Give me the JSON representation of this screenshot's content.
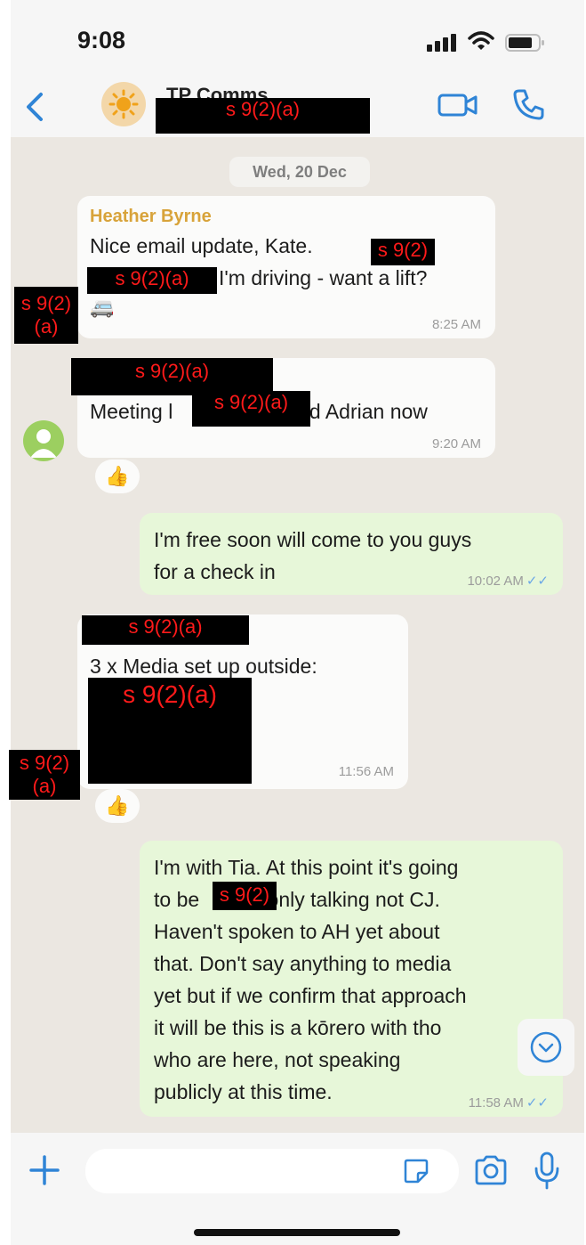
{
  "status_bar": {
    "time": "9:08",
    "signal_icon": "cellular-signal-icon",
    "wifi_icon": "wifi-icon",
    "battery_icon": "battery-icon"
  },
  "header": {
    "back_icon": "chevron-left-icon",
    "group_name": "TP Comms",
    "group_avatar_icon": "sun-icon",
    "subtitle_redaction": "s 9(2)(a)",
    "video_icon": "video-camera-icon",
    "call_icon": "phone-icon",
    "accent_color": "#2f84d6"
  },
  "chat": {
    "date": "Wed, 20 Dec",
    "messages": [
      {
        "sender": "Heather Byrne",
        "line1": "Nice email update, Kate.",
        "line1_redaction": "s 9(2)",
        "line2_redaction": "s 9(2)(a)",
        "line2": "I'm driving - want a lift?",
        "emoji": "🚐",
        "time": "8:25 AM",
        "avatar_redaction": "s 9(2)\n(a)"
      },
      {
        "sender_redaction": "s 9(2)(a)",
        "text_start": "Meeting l",
        "text_redaction": "s 9(2)(a)",
        "text_end": "and Adrian now",
        "time": "9:20 AM",
        "reaction": "👍"
      },
      {
        "line1": "I'm free soon will come to you guys",
        "line2": "for a check in",
        "time": "10:02 AM",
        "ticks": "✓✓"
      },
      {
        "sender_redaction": "s 9(2)(a)",
        "line1": "3 x Media set up outside:",
        "body_redaction": "s 9(2)(a)",
        "time": "11:56 AM",
        "avatar_redaction": "s 9(2)\n(a)",
        "reaction": "👍"
      },
      {
        "line1": "I'm with Tia. At this point it's going",
        "line2_start": "to be ",
        "line2_redaction": "s 9(2)",
        "line2_end": "only talking not CJ.",
        "line3": "Haven't spoken to AH yet about",
        "line4": "that. Don't say anything to media",
        "line5": "yet but if we confirm that approach",
        "line6": "it will be this is a kōrero with tho",
        "line7": "who are here, not speaking",
        "line8": "publicly at this time.",
        "time": "11:58 AM",
        "ticks": "✓✓"
      }
    ]
  },
  "input_bar": {
    "placeholder": "",
    "plus_icon": "plus-icon",
    "sticker_icon": "sticker-icon",
    "camera_icon": "camera-icon",
    "mic_icon": "microphone-icon"
  },
  "scroll_down_icon": "chevron-down-circle-icon",
  "colors": {
    "outgoing_bubble": "#e7f7d9",
    "incoming_bubble": "#fbfbfa",
    "chat_background": "#ebe7e1",
    "sender_name": "#d8a33a",
    "redaction_text": "#ff1a1a"
  }
}
